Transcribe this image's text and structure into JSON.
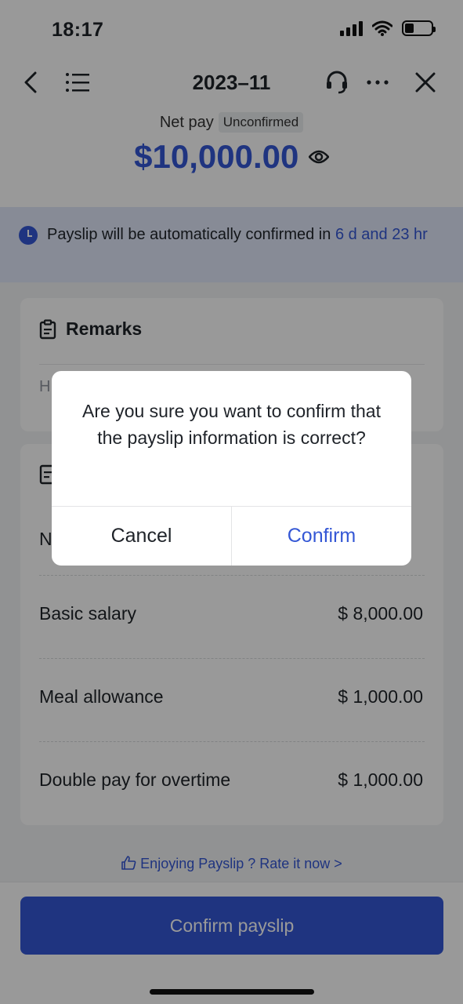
{
  "status_bar": {
    "time": "18:17",
    "battery_level": 0.35
  },
  "nav": {
    "title": "2023–11",
    "icons": [
      "back-icon",
      "list-icon",
      "headset-icon",
      "more-icon",
      "close-icon"
    ]
  },
  "summary": {
    "label": "Net pay",
    "status_badge": "Unconfirmed",
    "amount": "$10,000.00"
  },
  "notice": {
    "prefix": "Payslip will be automatically confirmed in ",
    "countdown": "6 d and 23 hr"
  },
  "remarks": {
    "title": "Remarks",
    "text": "H"
  },
  "details": {
    "title_partial": "N",
    "rows": [
      {
        "label": "Basic salary",
        "value": "$ 8,000.00"
      },
      {
        "label": "Meal allowance",
        "value": "$ 1,000.00"
      },
      {
        "label": "Double pay for overtime",
        "value": "$ 1,000.00"
      }
    ]
  },
  "rate_link": "Enjoying Payslip ? Rate it now >",
  "confirm_button": "Confirm payslip",
  "dialog": {
    "message": "Are you sure you want to confirm that the payslip information is correct?",
    "cancel": "Cancel",
    "confirm": "Confirm"
  },
  "colors": {
    "accent": "#3457d5",
    "notice_bg": "#e1e8fb",
    "overlay": "rgba(0,0,0,0.40)"
  }
}
